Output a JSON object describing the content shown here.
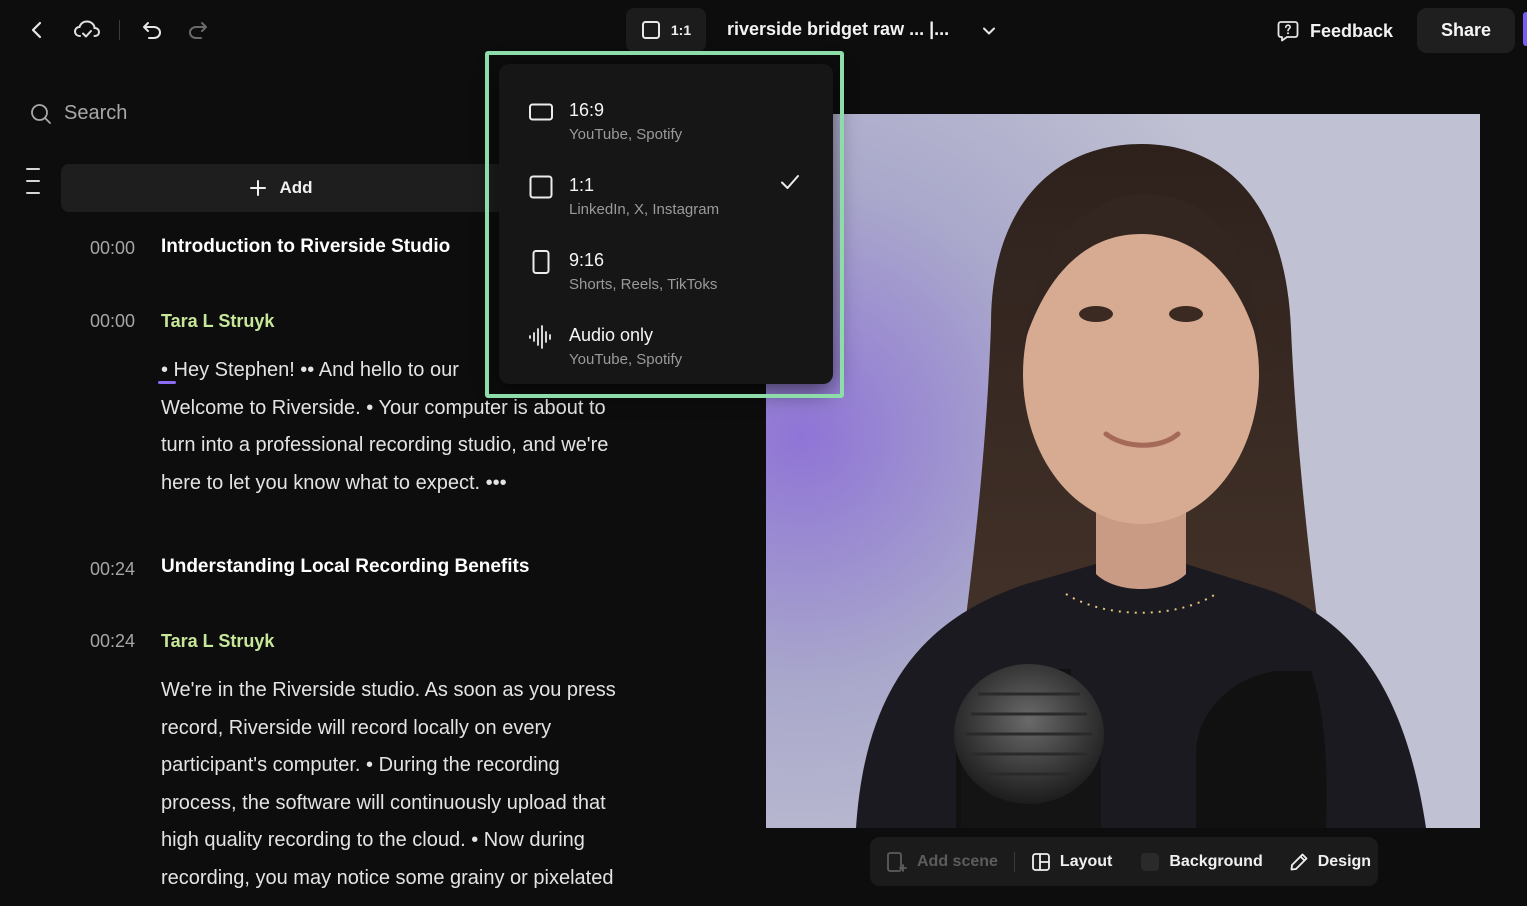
{
  "header": {
    "current_ratio": "1:1",
    "project_title": "riverside bridget raw ... |...",
    "feedback_label": "Feedback",
    "share_label": "Share"
  },
  "sidebar": {
    "search_placeholder": "Search",
    "add_label": "Add"
  },
  "transcript": [
    {
      "kind": "chapter",
      "time": "00:00",
      "title": "Introduction to Riverside Studio"
    },
    {
      "kind": "speaker",
      "time": "00:00",
      "name": "Tara L Struyk"
    },
    {
      "kind": "text",
      "lines": [
        "• Hey Stephen! •• And hello to our",
        "Welcome to Riverside. • Your computer is about to",
        "turn into a professional recording studio, and we're",
        "here to let you know what to expect. •••"
      ]
    },
    {
      "kind": "chapter",
      "time": "00:24",
      "title": "Understanding Local Recording Benefits"
    },
    {
      "kind": "speaker",
      "time": "00:24",
      "name": "Tara L Struyk"
    },
    {
      "kind": "text",
      "lines": [
        "We're in the Riverside studio. As soon as you press",
        "record, Riverside will record locally on every",
        "participant's computer. • During the recording",
        "process, the software will continuously upload that",
        "high quality recording to the cloud. • Now during",
        "recording, you may notice some grainy or pixelated"
      ]
    }
  ],
  "aspect_menu": {
    "options": [
      {
        "name": "16:9",
        "platforms": "YouTube, Spotify",
        "icon": "landscape-frame-icon",
        "selected": false
      },
      {
        "name": "1:1",
        "platforms": "LinkedIn, X, Instagram",
        "icon": "square-frame-icon",
        "selected": true
      },
      {
        "name": "9:16",
        "platforms": "Shorts, Reels, TikToks",
        "icon": "portrait-frame-icon",
        "selected": false
      },
      {
        "name": "Audio only",
        "platforms": "YouTube, Spotify",
        "icon": "waveform-icon",
        "selected": false
      }
    ]
  },
  "scene_toolbar": {
    "add_scene": "Add scene",
    "layout": "Layout",
    "background": "Background",
    "design": "Design"
  },
  "colors": {
    "accent_purple": "#7a5cf0",
    "speaker_green": "#c7e89a",
    "highlight_border": "#8fdcab"
  }
}
